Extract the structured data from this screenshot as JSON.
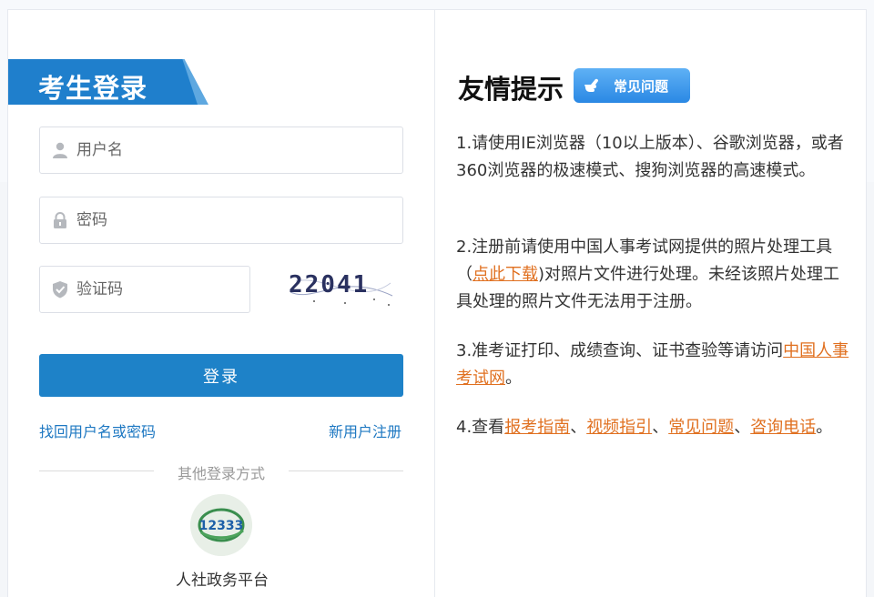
{
  "login": {
    "title": "考生登录",
    "username_placeholder": "用户名",
    "password_placeholder": "密码",
    "captcha_placeholder": "验证码",
    "captcha_text": "22041",
    "login_button": "登录",
    "forgot_link": "找回用户名或密码",
    "register_link": "新用户注册",
    "other_methods": "其他登录方式",
    "platform": {
      "logo_text": "12333",
      "label": "人社政务平台"
    }
  },
  "tips": {
    "title": "友情提示",
    "faq_badge": "常见问题",
    "tip1": "1.请使用IE浏览器（10以上版本）、谷歌浏览器，或者360浏览器的极速模式、搜狗浏览器的高速模式。",
    "tip2": {
      "before": "2.注册前请使用中国人事考试网提供的照片处理工具（",
      "link": "点此下载",
      "after": ")对照片文件进行处理。未经该照片处理工具处理的照片文件无法用于注册。"
    },
    "tip3": {
      "before": "3.准考证打印、成绩查询、证书查验等请访问",
      "link": "中国人事考试网",
      "after": "。"
    },
    "tip4": {
      "before": "4.查看",
      "link1": "报考指南",
      "sep1": "、",
      "link2": "视频指引",
      "sep2": "、",
      "link3": "常见问题",
      "sep3": "、",
      "link4": "咨询电话",
      "after": "。"
    }
  },
  "colors": {
    "primary": "#1e82c8",
    "link_blue": "#1e78c2",
    "link_orange": "#e07020"
  }
}
